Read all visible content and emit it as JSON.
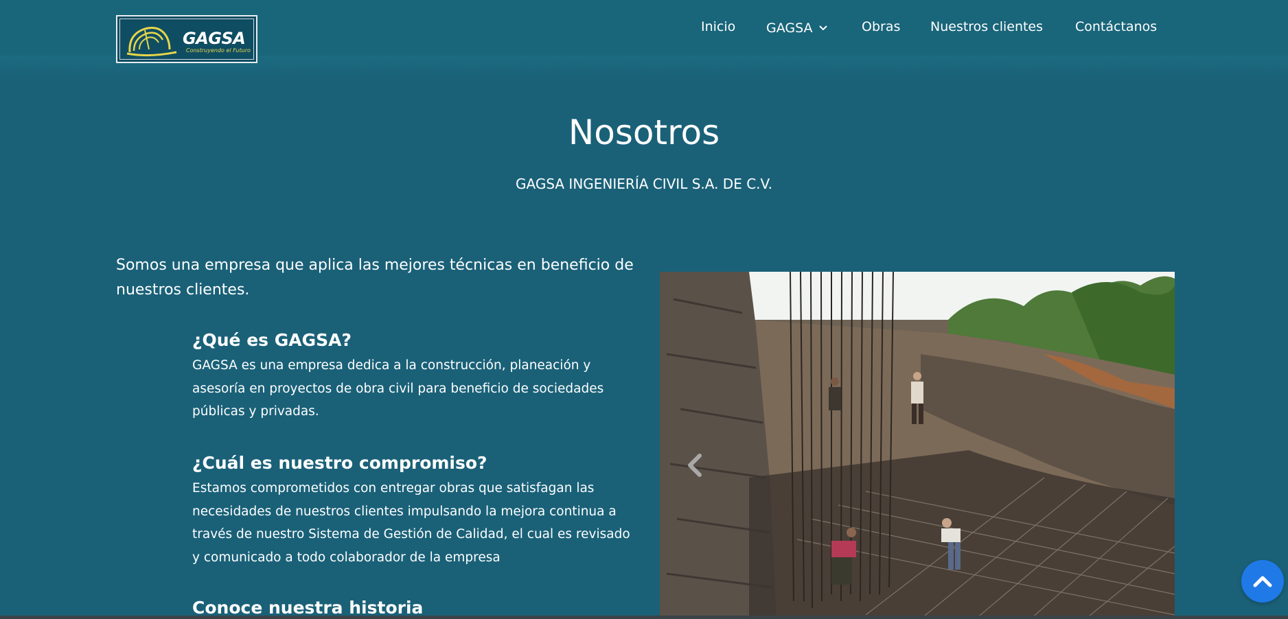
{
  "brand": {
    "name": "GAGSA",
    "tagline": "Construyendo el Futuro",
    "logo_accent": "#e7d64a"
  },
  "nav": {
    "items": [
      {
        "label": "Inicio"
      },
      {
        "label": "GAGSA",
        "has_dropdown": true,
        "icon": "chevron-down-icon"
      },
      {
        "label": "Obras"
      },
      {
        "label": "Nuestros clientes"
      },
      {
        "label": "Contáctanos"
      }
    ]
  },
  "hero": {
    "title": "Nosotros",
    "subtitle": "GAGSA INGENIERÍA CIVIL S.A. DE C.V."
  },
  "content": {
    "intro": "Somos una empresa que aplica las mejores técnicas en beneficio de nuestros clientes.",
    "sections": [
      {
        "heading": "¿Qué es GAGSA?",
        "body": "GAGSA es una empresa dedica a la construcción, planeación y asesoría en proyectos de obra civil para beneficio de sociedades públicas y privadas."
      },
      {
        "heading": "¿Cuál es nuestro compromiso?",
        "body": "Estamos comprometidos con entregar obras que satisfagan las necesidades de nuestros clientes impulsando la mejora continua a través de nuestro Sistema de Gestión de Calidad, el cual es revisado y comunicado a todo colaborador de la empresa"
      },
      {
        "heading": "Conoce nuestra historia",
        "body": ""
      }
    ]
  },
  "carousel": {
    "image_alt": "",
    "prev_icon": "chevron-left-icon"
  },
  "back_to_top": {
    "icon": "chevron-up-icon",
    "color": "#1f7ae8"
  },
  "theme": {
    "background": "#1a6178",
    "header": "#19657a"
  }
}
